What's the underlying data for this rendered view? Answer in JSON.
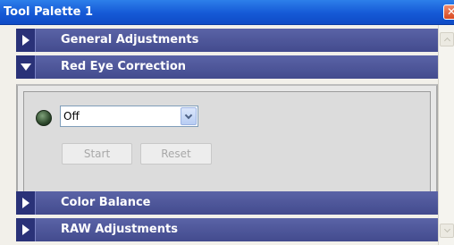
{
  "window": {
    "title": "Tool Palette 1",
    "close_glyph": "✕"
  },
  "sections": [
    {
      "label": "General Adjustments",
      "expanded": false
    },
    {
      "label": "Red Eye Correction",
      "expanded": true
    },
    {
      "label": "Color Balance",
      "expanded": false
    },
    {
      "label": "RAW Adjustments",
      "expanded": false
    }
  ],
  "red_eye": {
    "mode_value": "Off",
    "start_label": "Start",
    "reset_label": "Reset",
    "indicator_color": "#2f4a2d"
  },
  "colors": {
    "titlebar": "#1559d6",
    "section_header": "#434b8e",
    "close_button": "#d94a21"
  }
}
